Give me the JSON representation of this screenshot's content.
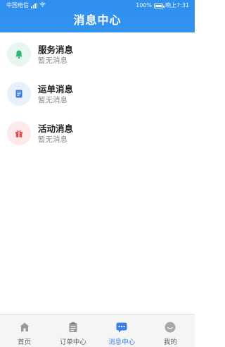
{
  "status_bar": {
    "carrier": "中国电信",
    "battery": "100%",
    "time": "晚上7:31"
  },
  "header": {
    "title": "消息中心"
  },
  "messages": [
    {
      "title": "服务消息",
      "subtitle": "暂无消息",
      "icon": "bell-icon",
      "color": "#2bb673",
      "bg": "#e7f6ee"
    },
    {
      "title": "运单消息",
      "subtitle": "暂无消息",
      "icon": "document-icon",
      "color": "#3b7ddd",
      "bg": "#e8f0fb"
    },
    {
      "title": "活动消息",
      "subtitle": "暂无消息",
      "icon": "gift-icon",
      "color": "#e94b4b",
      "bg": "#fde9e9"
    }
  ],
  "tabbar": {
    "items": [
      {
        "label": "首页",
        "icon": "home-icon",
        "active": false
      },
      {
        "label": "订单中心",
        "icon": "clipboard-icon",
        "active": false
      },
      {
        "label": "消息中心",
        "icon": "chat-icon",
        "active": true
      },
      {
        "label": "我的",
        "icon": "profile-icon",
        "active": false
      }
    ]
  },
  "colors": {
    "header": "#3294ef",
    "active_tab": "#3a7fe6",
    "inactive_tab": "#666666"
  }
}
